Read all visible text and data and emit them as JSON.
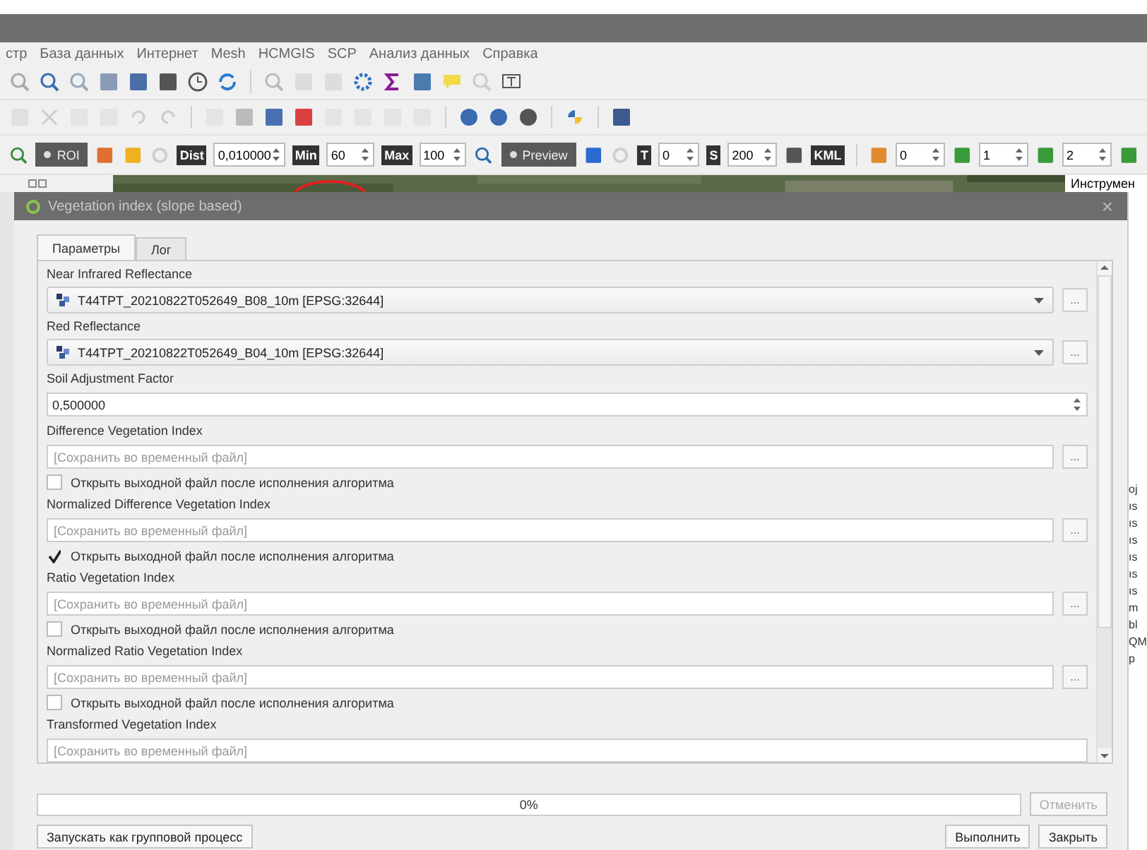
{
  "menu": [
    {
      "label": "стр"
    },
    {
      "label": "База данных"
    },
    {
      "label": "Интернет"
    },
    {
      "label": "Mesh"
    },
    {
      "label": "HCMGIS"
    },
    {
      "label": "SCP"
    },
    {
      "label": "Анализ данных"
    },
    {
      "label": "Справка"
    }
  ],
  "scp_toolbar": {
    "roi": "ROI",
    "dist_tag": "Dist",
    "dist": "0,010000",
    "min_tag": "Min",
    "min": "60",
    "max_tag": "Max",
    "max": "100",
    "preview": "Preview",
    "t_tag": "T",
    "t": "0",
    "s_tag": "S",
    "s": "200",
    "kml": "KML",
    "band_a": "0",
    "band_b": "1",
    "band_c": "2"
  },
  "side_panel": {
    "title": "Инструмен",
    "fragments": [
      "oj",
      "ıs",
      "ıs",
      "ıs",
      "ıs",
      "ıs",
      "ıs",
      "m",
      "bl",
      "QM",
      "p"
    ]
  },
  "dialog": {
    "title": "Vegetation index (slope based)",
    "close": "×",
    "tabs": [
      {
        "label": "Параметры",
        "selected": true
      },
      {
        "label": "Лог",
        "selected": false
      }
    ],
    "params": [
      {
        "kind": "combo",
        "label": "Near Infrared Reflectance",
        "value": "T44TPT_20210822T052649_B08_10m [EPSG:32644]",
        "button": "..."
      },
      {
        "kind": "combo",
        "label": "Red Reflectance",
        "value": "T44TPT_20210822T052649_B04_10m [EPSG:32644]",
        "button": "..."
      },
      {
        "kind": "spin",
        "label": "Soil Adjustment Factor",
        "value": "0,500000"
      },
      {
        "kind": "output",
        "label": "Difference Vegetation Index",
        "placeholder": "[Сохранить во временный файл]",
        "button": "...",
        "checkbox": {
          "label": "Открыть выходной файл после исполнения алгоритма",
          "checked": false
        }
      },
      {
        "kind": "output",
        "label": "Normalized Difference Vegetation Index",
        "placeholder": "[Сохранить во временный файл]",
        "button": "...",
        "checkbox": {
          "label": "Открыть выходной файл после исполнения алгоритма",
          "checked": true
        }
      },
      {
        "kind": "output",
        "label": "Ratio Vegetation Index",
        "placeholder": "[Сохранить во временный файл]",
        "button": "...",
        "checkbox": {
          "label": "Открыть выходной файл после исполнения алгоритма",
          "checked": false
        }
      },
      {
        "kind": "output",
        "label": "Normalized Ratio Vegetation Index",
        "placeholder": "[Сохранить во временный файл]",
        "button": "...",
        "checkbox": {
          "label": "Открыть выходной файл после исполнения алгоритма",
          "checked": false
        }
      },
      {
        "kind": "output",
        "label": "Transformed Vegetation Index",
        "placeholder": "[Сохранить во временный файл]"
      }
    ],
    "progress": {
      "level": 0,
      "text": "0%"
    },
    "cancel": {
      "label": "Отменить",
      "disabled": true
    },
    "batch": "Запускать как групповой процесс",
    "run": "Выполнить",
    "close_button": "Закрыть"
  }
}
